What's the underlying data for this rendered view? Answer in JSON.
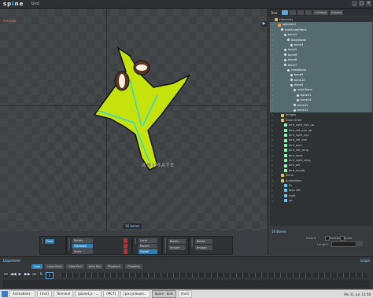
{
  "app": {
    "logo_main": "sp",
    "logo_accent": "i",
    "logo_tail": "ne",
    "window_title": "bird"
  },
  "window_buttons": [
    "_",
    "□",
    "✕"
  ],
  "viewport": {
    "mode": "Animate",
    "watermark": "ANIMATE",
    "bones_count": "16 bones",
    "play": "▶"
  },
  "tree": {
    "title": "Tree",
    "buttons": [
      "Collapse",
      "Expand"
    ],
    "rows": [
      {
        "label": "Hierarchy",
        "indent": 0,
        "icon": "folder",
        "sel": false
      },
      {
        "label": "spinebird",
        "indent": 1,
        "icon": "skel",
        "sel": true
      },
      {
        "label": "root/blue/fabric",
        "indent": 2,
        "icon": "bone",
        "sel": true
      },
      {
        "label": "bone2",
        "indent": 3,
        "icon": "bone",
        "sel": true
      },
      {
        "label": "body/bone",
        "indent": 4,
        "icon": "bone",
        "sel": true
      },
      {
        "label": "bone3",
        "indent": 5,
        "icon": "bone",
        "sel": true
      },
      {
        "label": "bone5",
        "indent": 3,
        "icon": "bone",
        "sel": true
      },
      {
        "label": "bone6",
        "indent": 3,
        "icon": "bone",
        "sel": true
      },
      {
        "label": "bone8",
        "indent": 3,
        "icon": "bone",
        "sel": true
      },
      {
        "label": "bone7",
        "indent": 3,
        "icon": "bone",
        "sel": true
      },
      {
        "label": "head/bone",
        "indent": 4,
        "icon": "bone",
        "sel": true
      },
      {
        "label": "bone9",
        "indent": 5,
        "icon": "bone",
        "sel": true
      },
      {
        "label": "bone10",
        "indent": 5,
        "icon": "bone",
        "sel": true
      },
      {
        "label": "bone4",
        "indent": 5,
        "icon": "bone",
        "sel": true
      },
      {
        "label": "neck/bone",
        "indent": 6,
        "icon": "bone",
        "sel": true
      },
      {
        "label": "bone11",
        "indent": 7,
        "icon": "bone",
        "sel": true
      },
      {
        "label": "bone14",
        "indent": 7,
        "icon": "bone",
        "sel": true
      },
      {
        "label": "bone15",
        "indent": 6,
        "icon": "bone",
        "sel": true
      },
      {
        "label": "bone12",
        "indent": 6,
        "icon": "bone",
        "sel": true
      },
      {
        "label": "Images",
        "indent": 2,
        "icon": "folder",
        "sel": false
      },
      {
        "label": "Draw Order",
        "indent": 2,
        "icon": "folder",
        "sel": false
      },
      {
        "label": "bird_right_eye_up",
        "indent": 3,
        "icon": "slot",
        "sel": false
      },
      {
        "label": "bird_left_eye_up",
        "indent": 3,
        "icon": "slot",
        "sel": false
      },
      {
        "label": "bird_right_eye",
        "indent": 3,
        "icon": "slot",
        "sel": false
      },
      {
        "label": "bird_left_eye",
        "indent": 3,
        "icon": "slot",
        "sel": false
      },
      {
        "label": "bird_back",
        "indent": 3,
        "icon": "slot",
        "sel": false
      },
      {
        "label": "bird_left_wing",
        "indent": 3,
        "icon": "slot",
        "sel": false
      },
      {
        "label": "bird_body",
        "indent": 3,
        "icon": "slot",
        "sel": false
      },
      {
        "label": "bird_right_wing",
        "indent": 3,
        "icon": "slot",
        "sel": false
      },
      {
        "label": "bird_tail",
        "indent": 3,
        "icon": "slot",
        "sel": false
      },
      {
        "label": "bird_mouth",
        "indent": 3,
        "icon": "slot",
        "sel": false
      },
      {
        "label": "Skins",
        "indent": 2,
        "icon": "folder",
        "sel": false
      },
      {
        "label": "Animations",
        "indent": 2,
        "icon": "folder",
        "sel": false
      },
      {
        "label": "fly",
        "indent": 3,
        "icon": "anim",
        "sel": false
      },
      {
        "label": "loop left",
        "indent": 3,
        "icon": "anim",
        "sel": false
      },
      {
        "label": "right",
        "indent": 3,
        "icon": "anim",
        "sel": false
      },
      {
        "label": "up",
        "indent": 3,
        "icon": "anim",
        "sel": false
      }
    ]
  },
  "props": {
    "title": "16 Bones",
    "inherit": "Inherit",
    "rotation": "Rotation",
    "scale": "Scale",
    "length": "Length:"
  },
  "toolbar": {
    "tools_label": "Tools",
    "transform_label": "Transform",
    "axes_label": "Axes",
    "compensate_label": "Compensate",
    "options_label": "Options",
    "pose": "Pose",
    "rotate": "Rotate",
    "translate": "Translate",
    "scale": "Scale",
    "local": "Local",
    "parent": "Parent",
    "global": "Global",
    "bones": "Bones",
    "images": "Images",
    "opt_bones": "Bones",
    "opt_images": "Images"
  },
  "timeline": {
    "title": "Dopesheet",
    "graph": "Graph",
    "tabs": [
      "Loop",
      "Loop Start",
      "Loop End",
      "Auto Key",
      "Playback",
      "Ghosting"
    ],
    "controls": [
      "⏮",
      "◀◀",
      "▶",
      "▶▶",
      "⏭",
      "↻"
    ],
    "frame": "0"
  },
  "taskbar": {
    "items": [
      "Animations -",
      "[mct]",
      "Terminal",
      "[planet.js - ...",
      "[MCT]",
      "[pixi.js/exam...",
      "Spine - bird",
      "[mct]"
    ],
    "active_index": 6,
    "clock": "Mo 31. Jul, 13:58"
  },
  "colors": {
    "accent": "#2f7fb5",
    "selection": "#566b70",
    "bird_green": "#c6e20d"
  }
}
